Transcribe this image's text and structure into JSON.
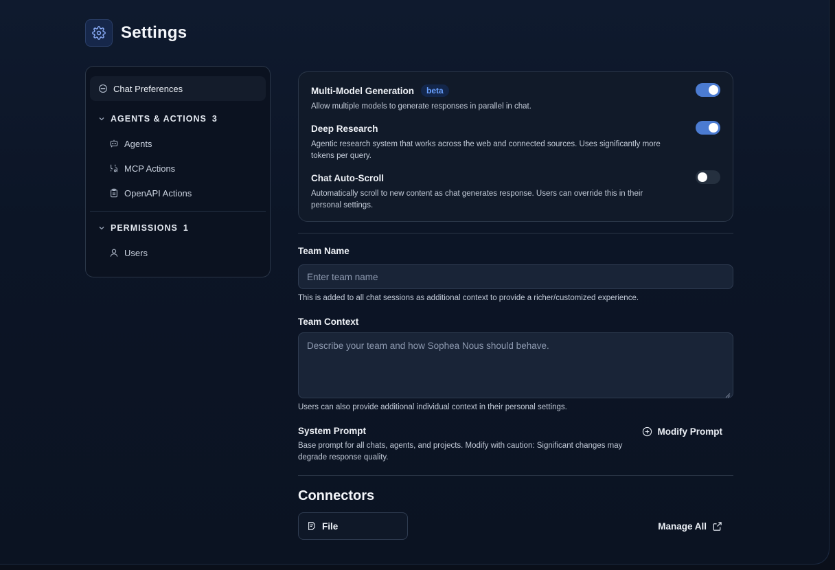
{
  "header": {
    "title": "Settings",
    "icon": "gear-icon"
  },
  "sidebar": {
    "active_item": {
      "label": "Chat Preferences",
      "icon": "chat-bubble-icon"
    },
    "groups": [
      {
        "title": "AGENTS & ACTIONS",
        "count": "3",
        "items": [
          {
            "label": "Agents",
            "icon": "agent-bot-icon"
          },
          {
            "label": "MCP Actions",
            "icon": "mcp-icon"
          },
          {
            "label": "OpenAPI Actions",
            "icon": "clipboard-icon"
          }
        ]
      },
      {
        "title": "PERMISSIONS",
        "count": "1",
        "items": [
          {
            "label": "Users",
            "icon": "user-icon"
          }
        ]
      }
    ]
  },
  "toggles": [
    {
      "title": "Multi-Model Generation",
      "badge": "beta",
      "desc": "Allow multiple models to generate responses in parallel in chat.",
      "on": true
    },
    {
      "title": "Deep Research",
      "desc": "Agentic research system that works across the web and connected sources. Uses significantly more tokens per query.",
      "on": true
    },
    {
      "title": "Chat Auto-Scroll",
      "desc": "Automatically scroll to new content as chat generates response. Users can override this in their personal settings.",
      "on": false
    }
  ],
  "team_name": {
    "label": "Team Name",
    "placeholder": "Enter team name",
    "help": "This is added to all chat sessions as additional context to provide a richer/customized experience."
  },
  "team_context": {
    "label": "Team Context",
    "placeholder": "Describe your team and how Sophea Nous should behave.",
    "help": "Users can also provide additional individual context in their personal settings."
  },
  "system_prompt": {
    "label": "System Prompt",
    "help": "Base prompt for all chats, agents, and projects. Modify with caution: Significant changes may degrade response quality.",
    "button": "Modify Prompt"
  },
  "connectors": {
    "title": "Connectors",
    "items": [
      {
        "label": "File",
        "icon": "file-icon"
      }
    ],
    "manage_label": "Manage All"
  },
  "colors": {
    "accent": "#4b7bd1",
    "badge_text": "#6aa1ff",
    "background": "#0c1526"
  }
}
